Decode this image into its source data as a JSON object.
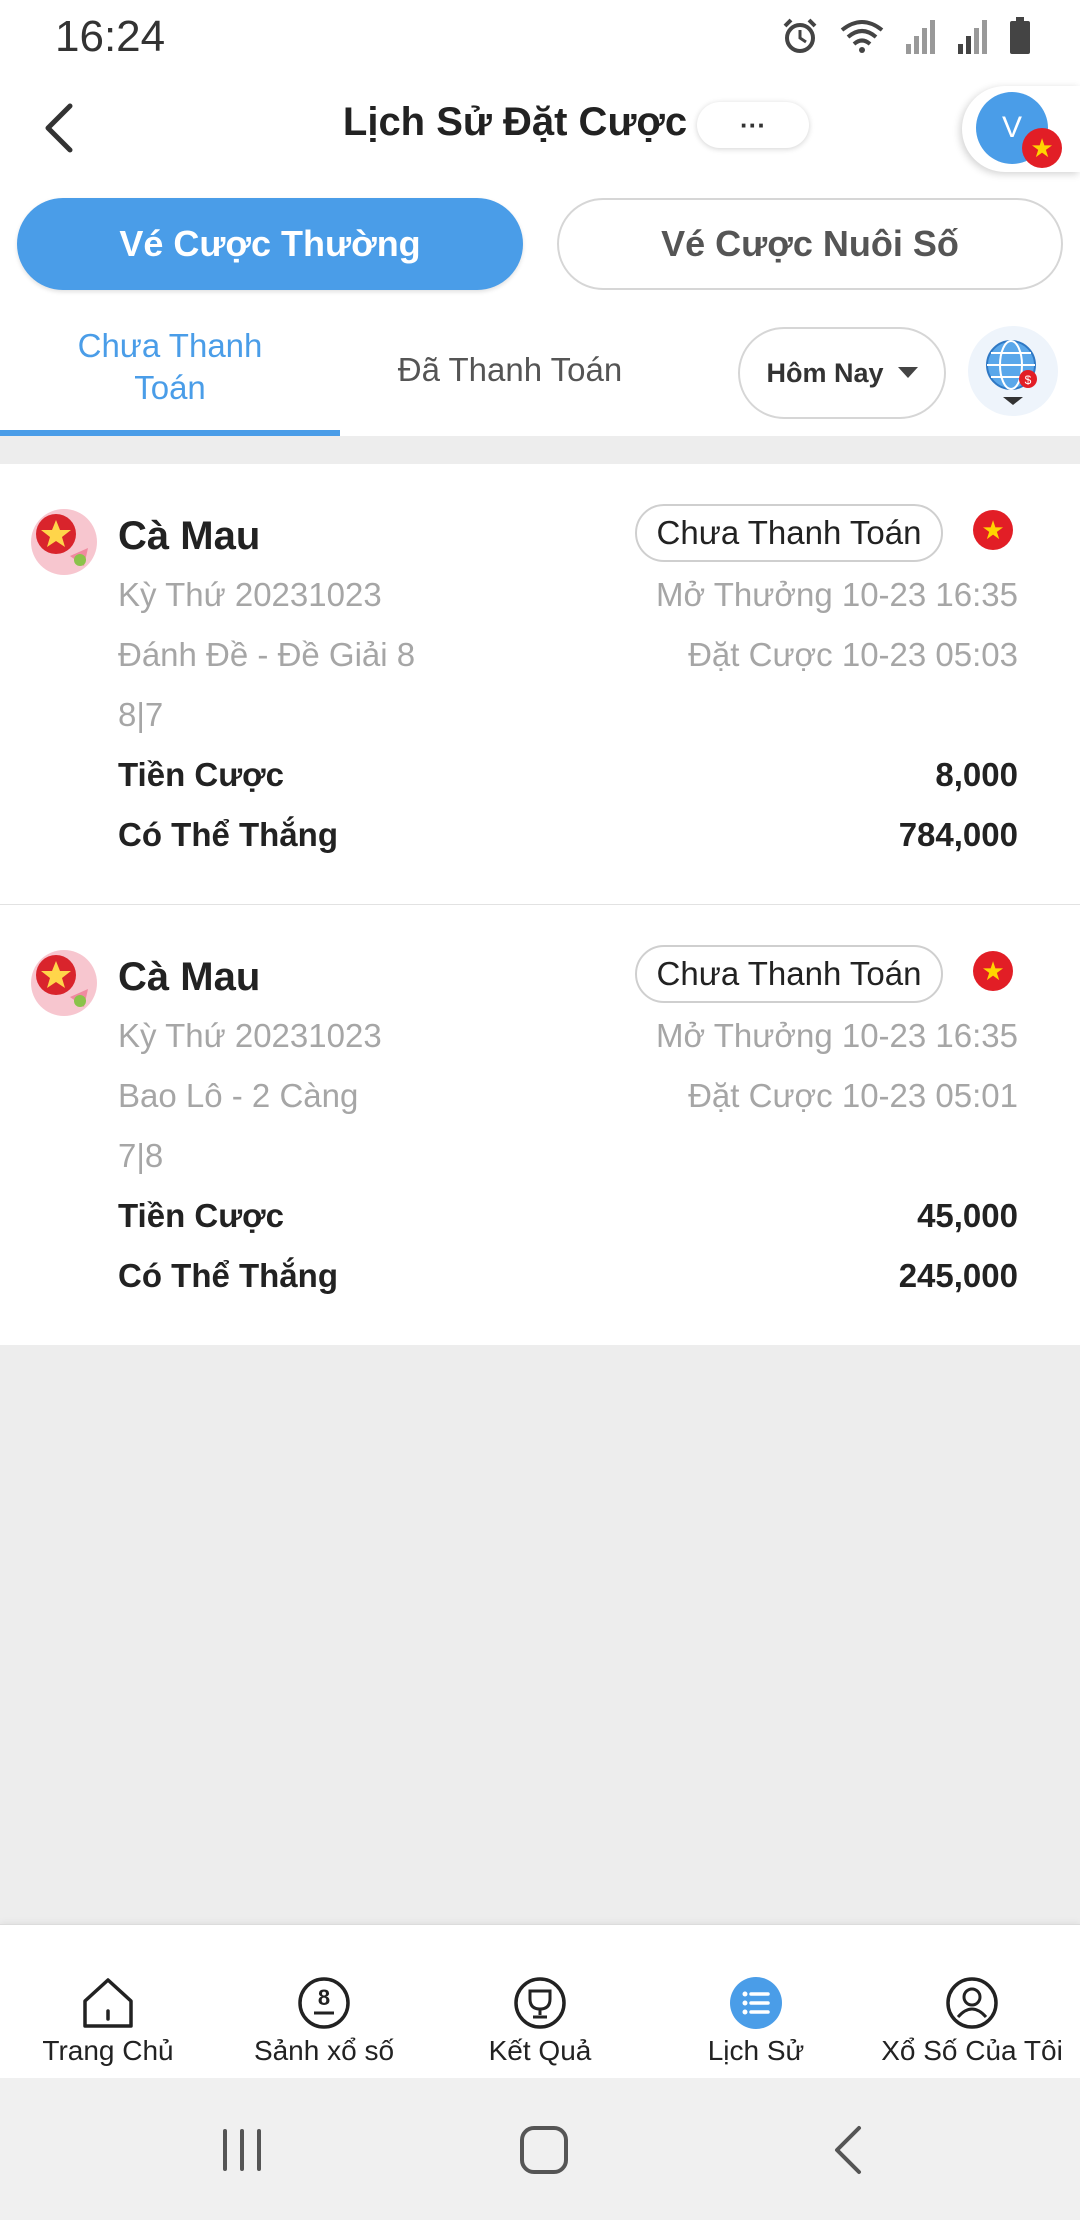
{
  "status_bar": {
    "time": "16:24"
  },
  "header": {
    "title": "Lịch Sử Đặt Cược",
    "more_label": "···",
    "avatar_letter": "V",
    "flag_glyph": "★"
  },
  "segments": {
    "active": "Vé Cược Thường",
    "inactive": "Vé Cược Nuôi Số"
  },
  "tabs": {
    "unpaid": "Chưa Thanh Toán",
    "paid": "Đã Thanh Toán",
    "date_filter": "Hôm Nay"
  },
  "colors": {
    "accent": "#4a9de8",
    "flag_red": "#e21e26",
    "flag_star": "#ffd500"
  },
  "bets": [
    {
      "title": "Cà Mau",
      "status": "Chưa Thanh Toán",
      "period": "Kỳ Thứ 20231023",
      "draw_time": "Mở Thưởng 10-23 16:35",
      "bet_type": "Đánh Đề - Đề Giải 8",
      "bet_time": "Đặt Cược 10-23 05:03",
      "numbers": "8|7",
      "stake_label": "Tiền Cược",
      "stake": "8,000",
      "win_label": "Có Thể Thắng",
      "win": "784,000"
    },
    {
      "title": "Cà Mau",
      "status": "Chưa Thanh Toán",
      "period": "Kỳ Thứ 20231023",
      "draw_time": "Mở Thưởng 10-23 16:35",
      "bet_type": "Bao Lô - 2 Càng",
      "bet_time": "Đặt Cược 10-23 05:01",
      "numbers": "7|8",
      "stake_label": "Tiền Cược",
      "stake": "45,000",
      "win_label": "Có Thể Thắng",
      "win": "245,000"
    }
  ],
  "bottom_nav": [
    {
      "label": "Trang Chủ",
      "icon": "home-icon"
    },
    {
      "label": "Sảnh xổ số",
      "icon": "lottery-ball-icon",
      "glyph": "8"
    },
    {
      "label": "Kết Quả",
      "icon": "trophy-icon"
    },
    {
      "label": "Lịch Sử",
      "icon": "history-list-icon",
      "active": true
    },
    {
      "label": "Xổ Số Của Tôi",
      "icon": "user-icon"
    }
  ]
}
